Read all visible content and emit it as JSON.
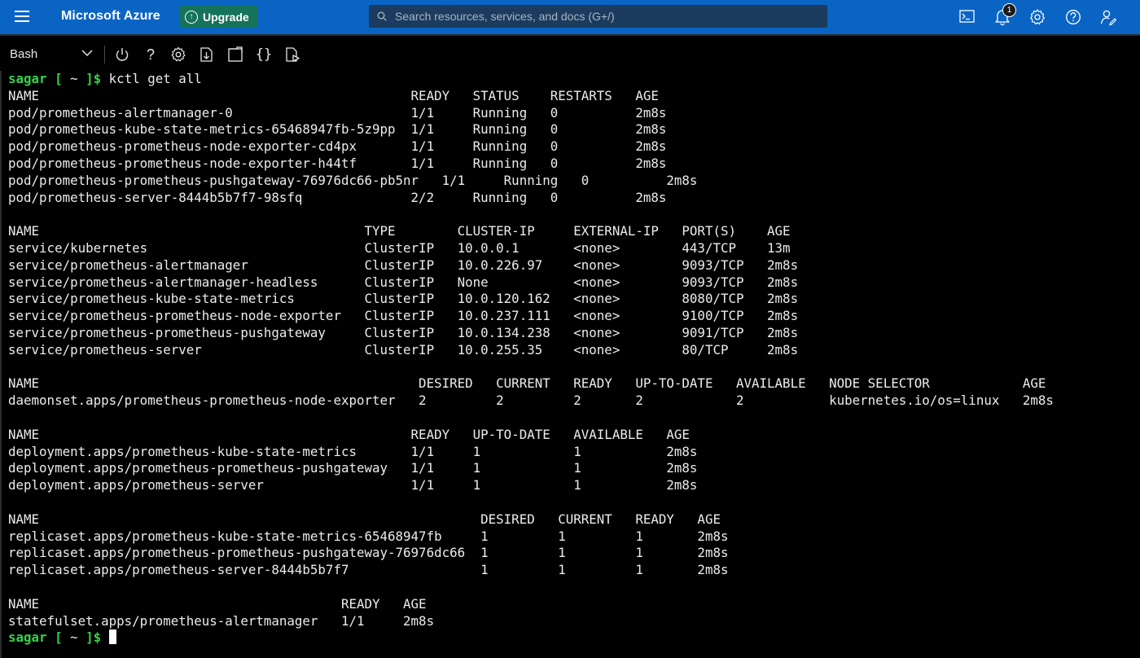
{
  "topbar": {
    "brand": "Microsoft Azure",
    "upgrade_label": "Upgrade",
    "search_placeholder": "Search resources, services, and docs (G+/)",
    "notification_count": "1",
    "colors": {
      "bar": "#0a64c4",
      "upgrade": "#15735a"
    }
  },
  "toolbar": {
    "shell": "Bash",
    "icons": [
      "power-icon",
      "help-icon",
      "settings-icon",
      "upload-download-icon",
      "open-new-session-icon",
      "editor-braces-icon",
      "web-preview-icon"
    ]
  },
  "terminal": {
    "user": "sagar",
    "path": "~",
    "command": "kctl get all",
    "output": "NAME                                                READY   STATUS    RESTARTS   AGE\npod/prometheus-alertmanager-0                       1/1     Running   0          2m8s\npod/prometheus-kube-state-metrics-65468947fb-5z9pp  1/1     Running   0          2m8s\npod/prometheus-prometheus-node-exporter-cd4px       1/1     Running   0          2m8s\npod/prometheus-prometheus-node-exporter-h44tf       1/1     Running   0          2m8s\npod/prometheus-prometheus-pushgateway-76976dc66-pb5nr   1/1     Running   0          2m8s\npod/prometheus-server-8444b5b7f7-98sfq              2/2     Running   0          2m8s\n\nNAME                                          TYPE        CLUSTER-IP     EXTERNAL-IP   PORT(S)    AGE\nservice/kubernetes                            ClusterIP   10.0.0.1       <none>        443/TCP    13m\nservice/prometheus-alertmanager               ClusterIP   10.0.226.97    <none>        9093/TCP   2m8s\nservice/prometheus-alertmanager-headless      ClusterIP   None           <none>        9093/TCP   2m8s\nservice/prometheus-kube-state-metrics         ClusterIP   10.0.120.162   <none>        8080/TCP   2m8s\nservice/prometheus-prometheus-node-exporter   ClusterIP   10.0.237.111   <none>        9100/TCP   2m8s\nservice/prometheus-prometheus-pushgateway     ClusterIP   10.0.134.238   <none>        9091/TCP   2m8s\nservice/prometheus-server                     ClusterIP   10.0.255.35    <none>        80/TCP     2m8s\n\nNAME                                                 DESIRED   CURRENT   READY   UP-TO-DATE   AVAILABLE   NODE SELECTOR            AGE\ndaemonset.apps/prometheus-prometheus-node-exporter   2         2         2       2            2           kubernetes.io/os=linux   2m8s\n\nNAME                                                READY   UP-TO-DATE   AVAILABLE   AGE\ndeployment.apps/prometheus-kube-state-metrics       1/1     1            1           2m8s\ndeployment.apps/prometheus-prometheus-pushgateway   1/1     1            1           2m8s\ndeployment.apps/prometheus-server                   1/1     1            1           2m8s\n\nNAME                                                         DESIRED   CURRENT   READY   AGE\nreplicaset.apps/prometheus-kube-state-metrics-65468947fb     1         1         1       2m8s\nreplicaset.apps/prometheus-prometheus-pushgateway-76976dc66  1         1         1       2m8s\nreplicaset.apps/prometheus-server-8444b5b7f7                 1         1         1       2m8s\n\nNAME                                       READY   AGE\nstatefulset.apps/prometheus-alertmanager   1/1     2m8s"
  }
}
